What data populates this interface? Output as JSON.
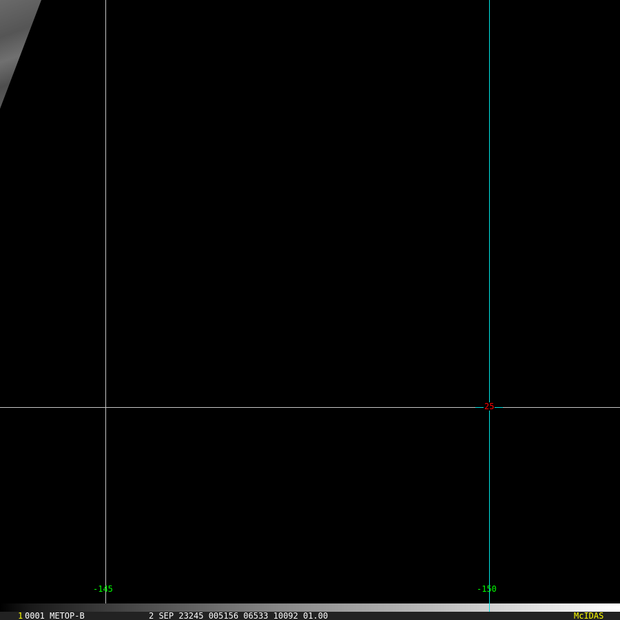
{
  "grid": {
    "lon_labels": [
      "-145",
      "-150"
    ],
    "lat_label": "25"
  },
  "status": {
    "frame": "1",
    "info": "0001 METOP-B",
    "datetime": "2 SEP 23245 005156 06533 10092 01.00",
    "brand": "McIDAS"
  },
  "colors": {
    "grid": "#c8c8c8",
    "meridian": "#00e5e5",
    "lon_label": "#00ff00",
    "lat_label": "#ff0000",
    "brand": "#ffff00"
  }
}
